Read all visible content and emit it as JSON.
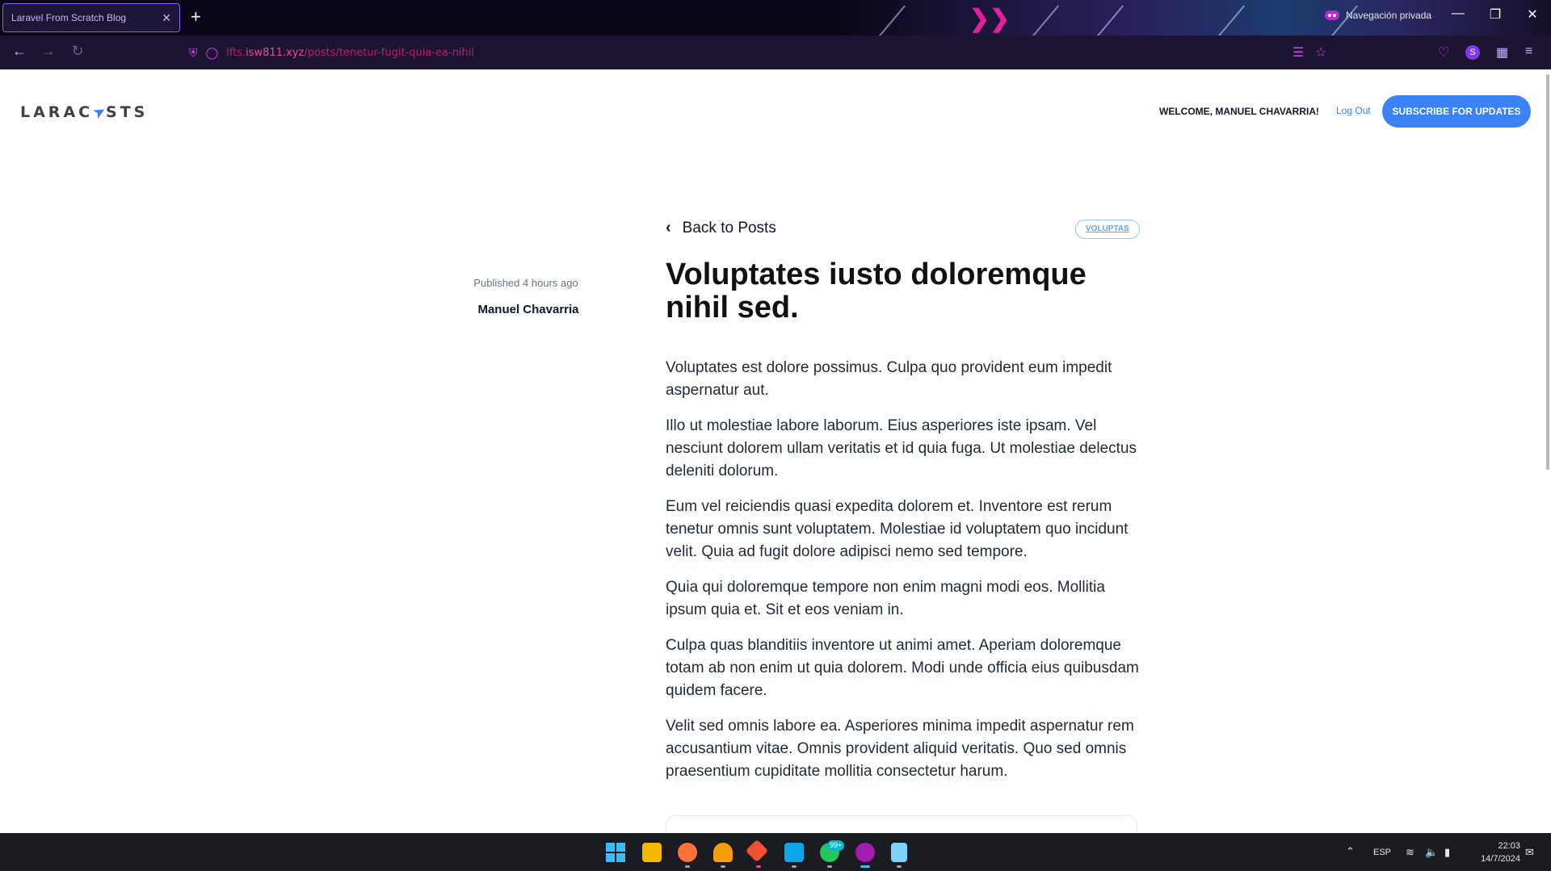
{
  "browser": {
    "tab_title": "Laravel From Scratch Blog",
    "private_label": "Navegación privada",
    "url_prefix": "lfts.",
    "url_host": "isw811.xyz",
    "url_path": "/posts/tenetur-fugit-quia-ea-nihil",
    "profile_initial": "S",
    "icons": [
      "back-arrow-icon",
      "forward-arrow-icon",
      "reload-icon",
      "shield-icon",
      "lock-icon",
      "reader-view-icon",
      "bookmark-star-icon",
      "pocket-icon",
      "extensions-icon",
      "menu-icon"
    ],
    "accent": "#d946ef"
  },
  "header": {
    "logo": "LARACASTS",
    "welcome": "WELCOME, MANUEL CHAVARRIA!",
    "logout": "Log Out",
    "subscribe": "SUBSCRIBE FOR UPDATES",
    "accent": "#3b82f6"
  },
  "post": {
    "published_prefix": "Published",
    "published_time": "4 hours ago",
    "author": "Manuel Chavarria",
    "back_label": "Back to Posts",
    "category": "VOLUPTAS",
    "title": "Voluptates iusto doloremque nihil sed.",
    "paragraphs": [
      "Voluptates est dolore possimus. Culpa quo provident eum impedit aspernatur aut.",
      "Illo ut molestiae labore laborum. Eius asperiores iste ipsam. Vel nesciunt dolorem ullam veritatis et id quia fuga. Ut molestiae delectus deleniti dolorum.",
      "Eum vel reiciendis quasi expedita dolorem et. Inventore est rerum tenetur omnis sunt voluptatem. Molestiae id voluptatem quo incidunt velit. Quia ad fugit dolore adipisci nemo sed tempore.",
      "Quia qui doloremque tempore non enim magni modi eos. Mollitia ipsum quia et. Sit et eos veniam in.",
      "Culpa quas blanditiis inventore ut animi amet. Aperiam doloremque totam ab non enim ut quia dolorem. Modi unde officia eius quibusdam quidem facere.",
      "Velit sed omnis labore ea. Asperiores minima impedit aspernatur rem accusantium vitae. Omnis provident aliquid veritatis. Quo sed omnis praesentium cupiditate mollitia consectetur harum."
    ]
  },
  "taskbar": {
    "apps": [
      "start-menu-icon",
      "file-explorer-icon",
      "firefox-icon",
      "app-icon",
      "git-icon",
      "vscode-icon",
      "whatsapp-icon",
      "firefox-private-icon",
      "notepad-icon"
    ],
    "whatsapp_badge": "99+",
    "language": "ESP",
    "time": "22:03",
    "date": "14/7/2024"
  }
}
